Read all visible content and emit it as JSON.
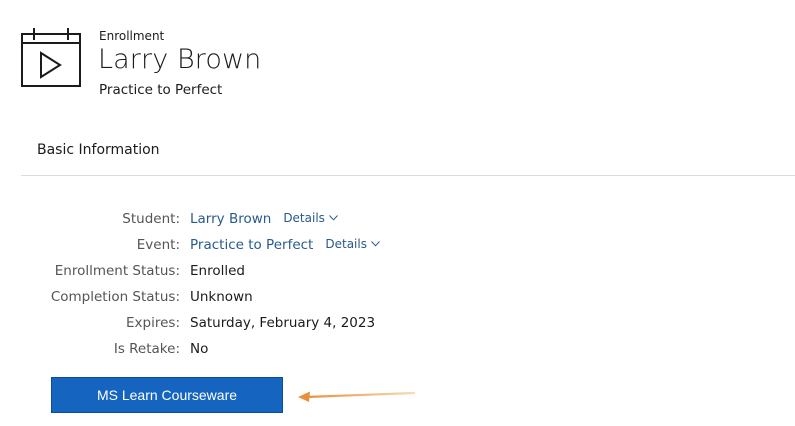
{
  "header": {
    "icon": "video-calendar-icon",
    "eyebrow": "Enrollment",
    "title": "Larry Brown",
    "subtitle": "Practice to Perfect"
  },
  "section": {
    "title": "Basic Information"
  },
  "fields": {
    "student": {
      "label": "Student:",
      "value": "Larry Brown",
      "details": "Details"
    },
    "event": {
      "label": "Event:",
      "value": "Practice to Perfect",
      "details": "Details"
    },
    "enrollment_status": {
      "label": "Enrollment Status:",
      "value": "Enrolled"
    },
    "completion_status": {
      "label": "Completion Status:",
      "value": "Unknown"
    },
    "expires": {
      "label": "Expires:",
      "value": "Saturday, February 4, 2023"
    },
    "is_retake": {
      "label": "Is Retake:",
      "value": "No"
    }
  },
  "actions": {
    "courseware_button": "MS Learn Courseware"
  },
  "colors": {
    "link": "#2a5a8c",
    "button": "#1565c0",
    "annotation_arrow": "#e8913a"
  }
}
